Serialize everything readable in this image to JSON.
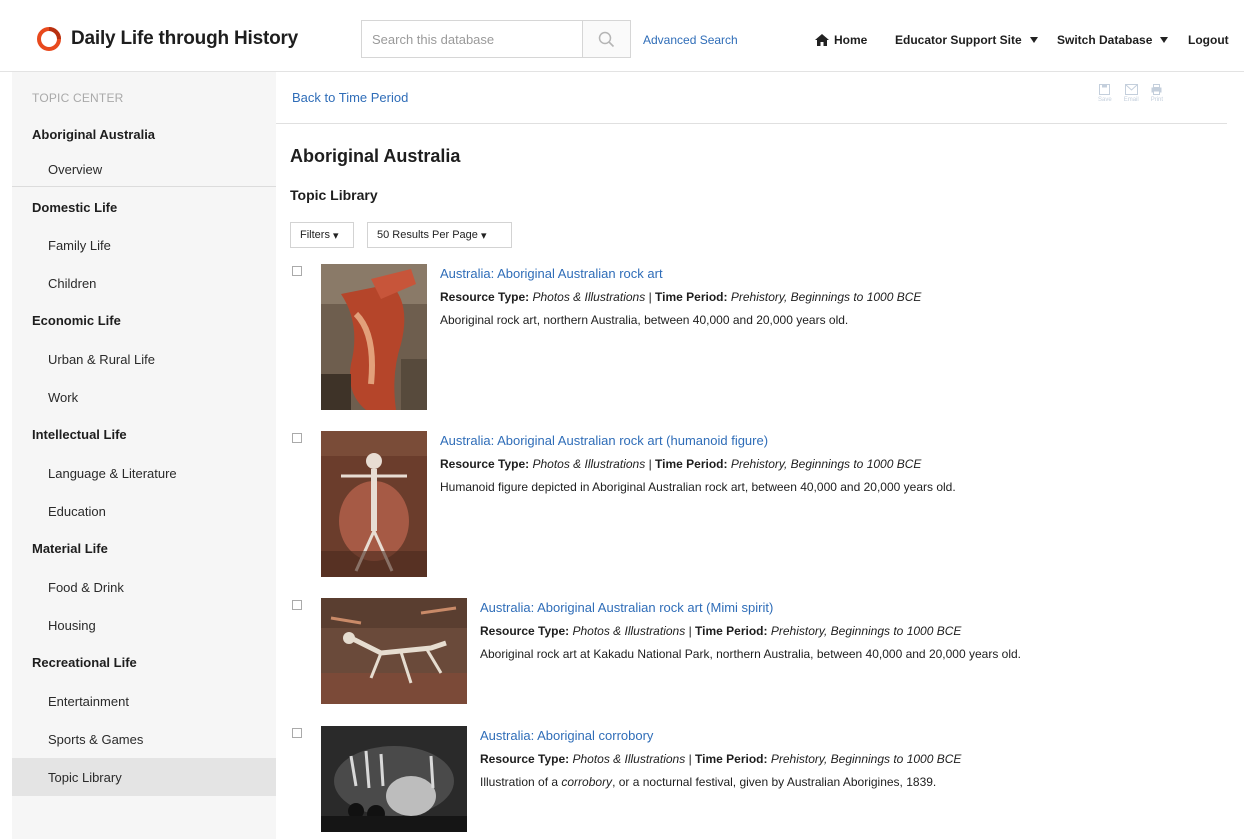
{
  "header": {
    "logo_text": "Daily Life through History",
    "search_placeholder": "Search this database",
    "advanced_search": "Advanced Search",
    "nav": {
      "home": "Home",
      "educator": "Educator Support Site",
      "switch": "Switch Database",
      "logout": "Logout"
    },
    "brand_color": "#e8491d"
  },
  "sidebar": {
    "heading": "TOPIC CENTER",
    "topic": "Aboriginal Australia",
    "overview": "Overview",
    "sections": [
      {
        "label": "Domestic Life",
        "items": [
          "Family Life",
          "Children"
        ]
      },
      {
        "label": "Economic Life",
        "items": [
          "Urban & Rural Life",
          "Work"
        ]
      },
      {
        "label": "Intellectual Life",
        "items": [
          "Language & Literature",
          "Education"
        ]
      },
      {
        "label": "Material Life",
        "items": [
          "Food & Drink",
          "Housing"
        ]
      },
      {
        "label": "Recreational Life",
        "items": [
          "Entertainment",
          "Sports & Games",
          "Topic Library"
        ]
      }
    ],
    "active_item": "Topic Library"
  },
  "main": {
    "back_link": "Back to Time Period",
    "tools": {
      "save": "Save",
      "email": "Email",
      "print": "Print"
    },
    "page_title": "Aboriginal Australia",
    "section_title": "Topic Library",
    "filters": "Filters",
    "per_page": "50 Results Per Page",
    "meta_labels": {
      "resource_type": "Resource Type:",
      "time_period": "Time Period:",
      "separator": "|"
    },
    "results": [
      {
        "title": "Australia: Aboriginal Australian rock art",
        "resource_type": "Photos & Illustrations",
        "time_period": "Prehistory, Beginnings to 1000 BCE",
        "description": "Aboriginal rock art, northern Australia, between 40,000 and 20,000 years old."
      },
      {
        "title": "Australia: Aboriginal Australian rock art (humanoid figure)",
        "resource_type": "Photos & Illustrations",
        "time_period": "Prehistory, Beginnings to 1000 BCE",
        "description": "Humanoid figure depicted in Aboriginal Australian rock art, between 40,000 and 20,000 years old."
      },
      {
        "title": "Australia: Aboriginal Australian rock art (Mimi spirit)",
        "resource_type": "Photos & Illustrations",
        "time_period": "Prehistory, Beginnings to 1000 BCE",
        "description": "Aboriginal rock art at Kakadu National Park, northern Australia, between 40,000 and 20,000 years old."
      },
      {
        "title": "Australia: Aboriginal corrobory",
        "resource_type": "Photos & Illustrations",
        "time_period": "Prehistory, Beginnings to 1000 BCE",
        "description_pre": "Illustration of a ",
        "description_em": "corrobory",
        "description_post": ", or a nocturnal festival, given by Australian Aborigines, 1839."
      }
    ]
  }
}
